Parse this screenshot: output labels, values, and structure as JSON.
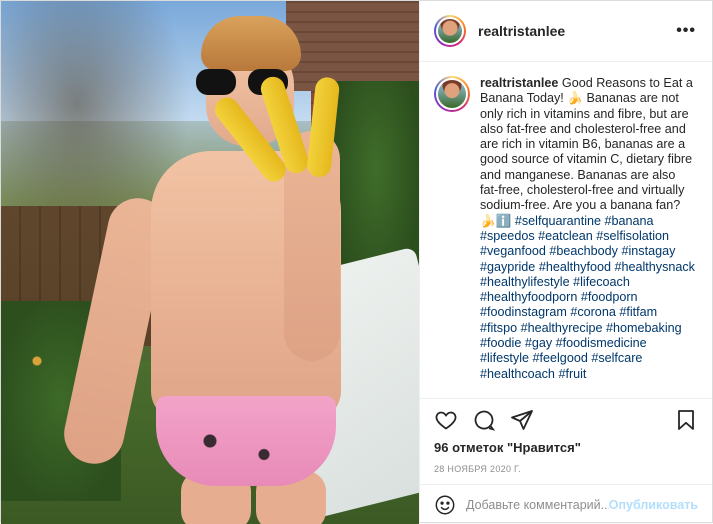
{
  "post": {
    "username": "realtristanlee",
    "more_label": "•••"
  },
  "caption": {
    "username": "realtristanlee",
    "text": "Good Reasons to Eat a Banana Today! 🍌 Bananas are not only rich in vitamins and fibre, but are also fat-free and cholesterol-free and are rich in vitamin B6, bananas are a good source of vitamin C, dietary fibre and manganese. Bananas are also fat-free, cholesterol-free and virtually sodium-free. Are you a banana fan? 🍌ℹ️",
    "hashtags": [
      "#selfquarantine",
      "#banana",
      "#speedos",
      "#eatclean",
      "#selfisolation",
      "#veganfood",
      "#beachbody",
      "#instagay",
      "#gaypride",
      "#healthyfood",
      "#healthysnack",
      "#healthylifestyle",
      "#lifecoach",
      "#healthyfoodporn",
      "#foodporn",
      "#foodinstagram",
      "#corona",
      "#fitfam",
      "#fitspo",
      "#healthyrecipe",
      "#homebaking",
      "#foodie",
      "#gay",
      "#foodismedicine",
      "#lifestyle",
      "#feelgood",
      "#selfcare",
      "#healthcoach",
      "#fruit"
    ]
  },
  "stats": {
    "likes": "96 отметок \"Нравится\"",
    "date": "28 НОЯБРЯ 2020 Г."
  },
  "comment": {
    "placeholder": "Добавьте комментарий...",
    "publish_label": "Опубликовать"
  },
  "icons": [
    "heart-icon",
    "comment-icon",
    "share-icon",
    "bookmark-icon",
    "smile-icon"
  ],
  "colors": {
    "hashtag": "#00376b",
    "publish": "#b2dffc",
    "muted": "#8e8e8e"
  }
}
